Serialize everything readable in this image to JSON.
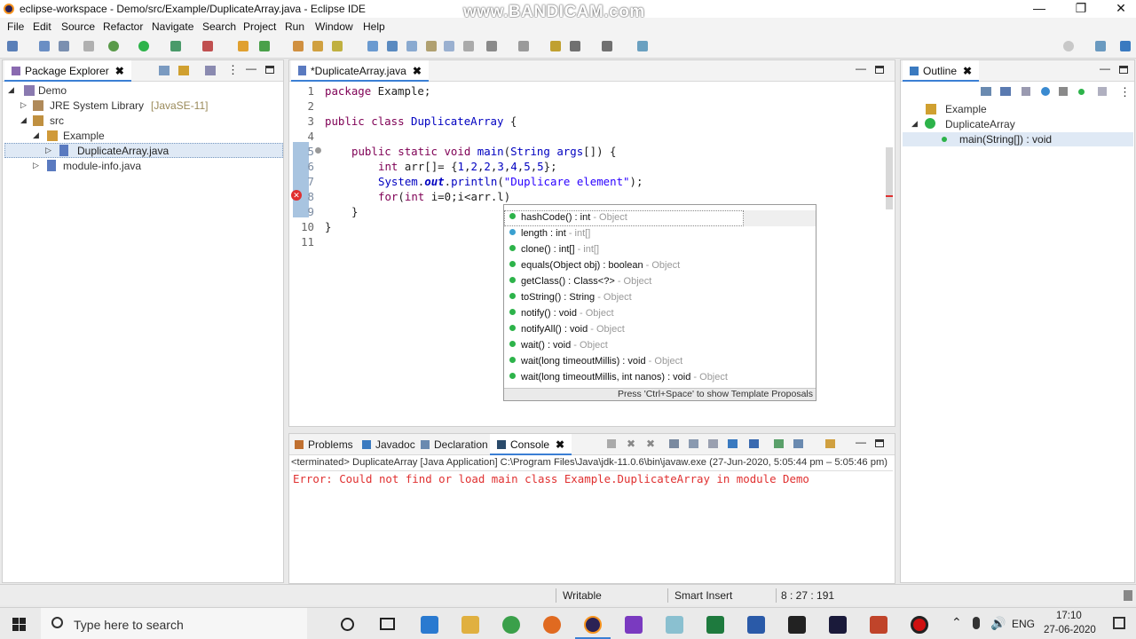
{
  "window": {
    "title": "eclipse-workspace - Demo/src/Example/DuplicateArray.java - Eclipse IDE",
    "watermark": "www.BANDICAM.com"
  },
  "menu": [
    "File",
    "Edit",
    "Source",
    "Refactor",
    "Navigate",
    "Search",
    "Project",
    "Run",
    "Window",
    "Help"
  ],
  "package_explorer": {
    "tab": "Package Explorer",
    "tree": [
      {
        "label": "Demo",
        "suffix": ""
      },
      {
        "label": "JRE System Library",
        "suffix": "[JavaSE-11]"
      },
      {
        "label": "src",
        "suffix": ""
      },
      {
        "label": "Example",
        "suffix": ""
      },
      {
        "label": "DuplicateArray.java",
        "suffix": ""
      },
      {
        "label": "module-info.java",
        "suffix": ""
      }
    ]
  },
  "editor": {
    "tab": "*DuplicateArray.java",
    "line_numbers": [
      "1",
      "2",
      "3",
      "4",
      "5",
      "6",
      "7",
      "8",
      "9",
      "10",
      "11"
    ]
  },
  "autocomplete": {
    "proposals": [
      {
        "name": "hashCode() : int",
        "type": " - Object"
      },
      {
        "name": "length : int",
        "type": " - int[]"
      },
      {
        "name": "clone() : int[]",
        "type": " - int[]"
      },
      {
        "name": "equals(Object obj) : boolean",
        "type": " - Object"
      },
      {
        "name": "getClass() : Class<?>",
        "type": " - Object"
      },
      {
        "name": "toString() : String",
        "type": " - Object"
      },
      {
        "name": "notify() : void",
        "type": " - Object"
      },
      {
        "name": "notifyAll() : void",
        "type": " - Object"
      },
      {
        "name": "wait() : void",
        "type": " - Object"
      },
      {
        "name": "wait(long timeoutMillis) : void",
        "type": " - Object"
      },
      {
        "name": "wait(long timeoutMillis, int nanos) : void",
        "type": " - Object"
      }
    ],
    "footer": "Press 'Ctrl+Space' to show Template Proposals"
  },
  "outline": {
    "tab": "Outline",
    "items": [
      "Example",
      "DuplicateArray",
      "main(String[]) : void"
    ]
  },
  "bottom": {
    "tabs": [
      "Problems",
      "Javadoc",
      "Declaration",
      "Console"
    ],
    "terminated": "<terminated> DuplicateArray [Java Application] C:\\Program Files\\Java\\jdk-11.0.6\\bin\\javaw.exe  (27-Jun-2020, 5:05:44 pm – 5:05:46 pm)",
    "error": "Error: Could not find or load main class Example.DuplicateArray in module Demo"
  },
  "statusbar": {
    "writable": "Writable",
    "insert": "Smart Insert",
    "position": "8 : 27 : 191"
  },
  "taskbar": {
    "search_placeholder": "Type here to search",
    "lang": "ENG",
    "time": "17:10",
    "date": "27-06-2020"
  },
  "colors": {
    "accent": "#3b7fd4",
    "keyword": "#7f0055",
    "string": "#2a00ff",
    "error": "#e03030"
  }
}
